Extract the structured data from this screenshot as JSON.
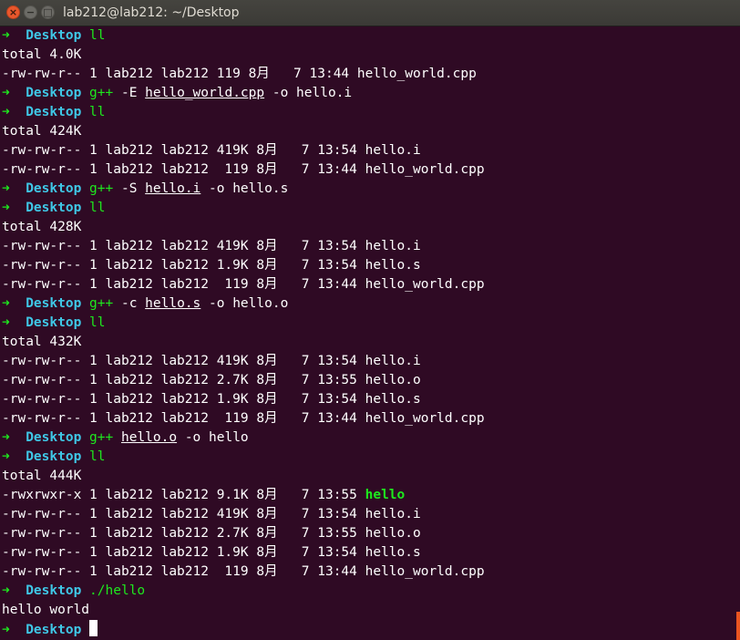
{
  "window": {
    "title": "lab212@lab212: ~/Desktop",
    "close_glyph": "×",
    "minimize_glyph": "−",
    "maximize_glyph": "□"
  },
  "colors": {
    "background": "#300a24",
    "prompt_arrow": "#1ee81e",
    "prompt_dir": "#3fc7e6",
    "command": "#1ee81e",
    "text": "#ffffff",
    "scrollbar": "#e95420"
  },
  "icons": {
    "prompt_arrow": "arrow-right-icon",
    "cursor": "block-cursor-icon"
  },
  "prompt": {
    "arrow": "➜",
    "dir": "Desktop"
  },
  "terminal": {
    "lines": [
      {
        "type": "prompt",
        "cmd": "ll",
        "args": []
      },
      {
        "type": "out",
        "text": "total 4.0K"
      },
      {
        "type": "out",
        "text": "-rw-rw-r-- 1 lab212 lab212 119 8月   7 13:44 hello_world.cpp"
      },
      {
        "type": "prompt",
        "cmd": "g++",
        "args": [
          {
            "t": " -E "
          },
          {
            "t": "hello_world.cpp",
            "u": true
          },
          {
            "t": " -o hello.i"
          }
        ]
      },
      {
        "type": "prompt",
        "cmd": "ll",
        "args": []
      },
      {
        "type": "out",
        "text": "total 424K"
      },
      {
        "type": "out",
        "text": "-rw-rw-r-- 1 lab212 lab212 419K 8月   7 13:54 hello.i"
      },
      {
        "type": "out",
        "text": "-rw-rw-r-- 1 lab212 lab212  119 8月   7 13:44 hello_world.cpp"
      },
      {
        "type": "prompt",
        "cmd": "g++",
        "args": [
          {
            "t": " -S "
          },
          {
            "t": "hello.i",
            "u": true
          },
          {
            "t": " -o hello.s"
          }
        ]
      },
      {
        "type": "prompt",
        "cmd": "ll",
        "args": []
      },
      {
        "type": "out",
        "text": "total 428K"
      },
      {
        "type": "out",
        "text": "-rw-rw-r-- 1 lab212 lab212 419K 8月   7 13:54 hello.i"
      },
      {
        "type": "out",
        "text": "-rw-rw-r-- 1 lab212 lab212 1.9K 8月   7 13:54 hello.s"
      },
      {
        "type": "out",
        "text": "-rw-rw-r-- 1 lab212 lab212  119 8月   7 13:44 hello_world.cpp"
      },
      {
        "type": "prompt",
        "cmd": "g++",
        "args": [
          {
            "t": " -c "
          },
          {
            "t": "hello.s",
            "u": true
          },
          {
            "t": " -o hello.o"
          }
        ]
      },
      {
        "type": "prompt",
        "cmd": "ll",
        "args": []
      },
      {
        "type": "out",
        "text": "total 432K"
      },
      {
        "type": "out",
        "text": "-rw-rw-r-- 1 lab212 lab212 419K 8月   7 13:54 hello.i"
      },
      {
        "type": "out",
        "text": "-rw-rw-r-- 1 lab212 lab212 2.7K 8月   7 13:55 hello.o"
      },
      {
        "type": "out",
        "text": "-rw-rw-r-- 1 lab212 lab212 1.9K 8月   7 13:54 hello.s"
      },
      {
        "type": "out",
        "text": "-rw-rw-r-- 1 lab212 lab212  119 8月   7 13:44 hello_world.cpp"
      },
      {
        "type": "prompt",
        "cmd": "g++",
        "args": [
          {
            "t": " "
          },
          {
            "t": "hello.o",
            "u": true
          },
          {
            "t": " -o hello"
          }
        ]
      },
      {
        "type": "prompt",
        "cmd": "ll",
        "args": []
      },
      {
        "type": "out",
        "text": "total 444K"
      },
      {
        "type": "out",
        "text": "-rwxrwxr-x 1 lab212 lab212 9.1K 8月   7 13:55 ",
        "exec": "hello"
      },
      {
        "type": "out",
        "text": "-rw-rw-r-- 1 lab212 lab212 419K 8月   7 13:54 hello.i"
      },
      {
        "type": "out",
        "text": "-rw-rw-r-- 1 lab212 lab212 2.7K 8月   7 13:55 hello.o"
      },
      {
        "type": "out",
        "text": "-rw-rw-r-- 1 lab212 lab212 1.9K 8月   7 13:54 hello.s"
      },
      {
        "type": "out",
        "text": "-rw-rw-r-- 1 lab212 lab212  119 8月   7 13:44 hello_world.cpp"
      },
      {
        "type": "prompt",
        "cmd": "./hello",
        "args": []
      },
      {
        "type": "out",
        "text": "hello world"
      },
      {
        "type": "prompt",
        "cmd": "",
        "args": [],
        "cursor": true
      }
    ]
  }
}
